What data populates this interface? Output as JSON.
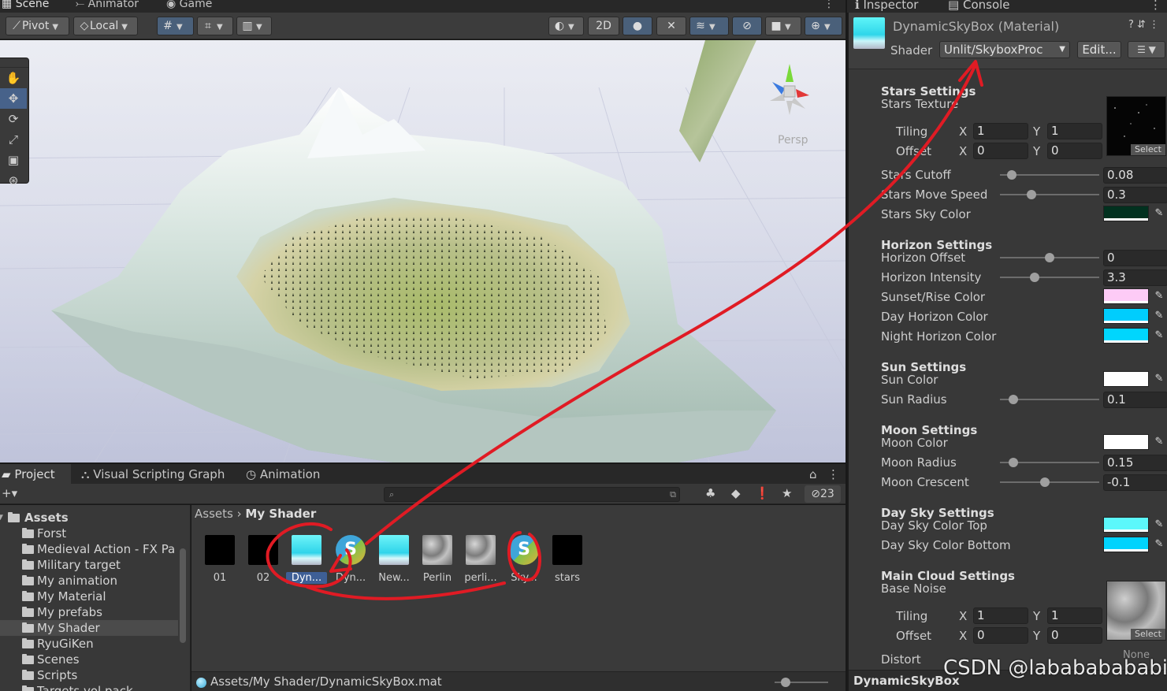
{
  "scene_window": {
    "tabs": [
      {
        "label": "Scene",
        "icon": "grid-icon"
      },
      {
        "label": "Animator",
        "icon": "animator-icon"
      },
      {
        "label": "Game",
        "icon": "gamepad-icon"
      }
    ],
    "toolbar": {
      "pivot_label": "Pivot",
      "local_label": "Local",
      "mode_2d_label": "2D"
    },
    "viewport": {
      "persp_label": "Persp"
    },
    "tools": [
      "hand-tool",
      "move-tool",
      "rotate-tool",
      "scale-tool",
      "rect-tool",
      "transform-tool"
    ]
  },
  "project_panel": {
    "tabs": [
      {
        "label": "Project",
        "icon": "folder-icon"
      },
      {
        "label": "Visual Scripting Graph",
        "icon": "graph-icon"
      },
      {
        "label": "Animation",
        "icon": "clock-icon"
      }
    ],
    "hidden_count": "23",
    "tree": [
      {
        "label": "Assets",
        "level": 0,
        "expanded": true,
        "bold": true
      },
      {
        "label": "Forst",
        "level": 1,
        "has_children": true
      },
      {
        "label": "Medieval Action - FX Pa",
        "level": 1
      },
      {
        "label": "Military target",
        "level": 1,
        "has_children": true
      },
      {
        "label": "My animation",
        "level": 1
      },
      {
        "label": "My Material",
        "level": 1
      },
      {
        "label": "My prefabs",
        "level": 1
      },
      {
        "label": "My Shader",
        "level": 1,
        "selected": true
      },
      {
        "label": "RyuGiKen",
        "level": 1,
        "has_children": true
      },
      {
        "label": "Scenes",
        "level": 1
      },
      {
        "label": "Scripts",
        "level": 1
      },
      {
        "label": "Targets vol pack",
        "level": 1
      }
    ],
    "breadcrumb": {
      "root": "Assets",
      "current": "My Shader"
    },
    "assets": [
      {
        "label": "01",
        "kind": "render-texture",
        "thumb": "#000000"
      },
      {
        "label": "02",
        "kind": "render-texture",
        "thumb": "#000000"
      },
      {
        "label": "Dyn...",
        "kind": "material",
        "selected": true
      },
      {
        "label": "Dyn...",
        "kind": "shader"
      },
      {
        "label": "New...",
        "kind": "material"
      },
      {
        "label": "Perlin",
        "kind": "texture-noise"
      },
      {
        "label": "perli...",
        "kind": "texture-noise"
      },
      {
        "label": "Sky...",
        "kind": "shader"
      },
      {
        "label": "stars",
        "kind": "texture-stars",
        "thumb": "#000000"
      }
    ],
    "status_path": "Assets/My Shader/DynamicSkyBox.mat"
  },
  "inspector": {
    "tabs": [
      {
        "label": "Inspector",
        "icon": "info-icon"
      },
      {
        "label": "Console",
        "icon": "console-icon"
      }
    ],
    "material_title": "DynamicSkyBox (Material)",
    "shader_label": "Shader",
    "shader_value": "Unlit/SkyboxProc",
    "edit_label": "Edit...",
    "sections": {
      "stars": "Stars Settings",
      "horizon": "Horizon Settings",
      "sun": "Sun Settings",
      "moon": "Moon Settings",
      "day_sky": "Day Sky Settings",
      "cloud": "Main Cloud Settings"
    },
    "labels": {
      "stars_texture": "Stars Texture",
      "tiling": "Tiling",
      "offset": "Offset",
      "x": "X",
      "y": "Y",
      "select": "Select",
      "stars_cutoff": "Stars Cutoff",
      "stars_move_speed": "Stars Move Speed",
      "stars_sky_color": "Stars Sky Color",
      "horizon_offset": "Horizon Offset",
      "horizon_intensity": "Horizon Intensity",
      "sunset_rise_color": "Sunset/Rise Color",
      "day_horizon_color": "Day Horizon Color",
      "night_horizon_color": "Night Horizon Color",
      "sun_color": "Sun Color",
      "sun_radius": "Sun Radius",
      "moon_color": "Moon Color",
      "moon_radius": "Moon Radius",
      "moon_crescent": "Moon Crescent",
      "day_sky_color_top": "Day Sky Color Top",
      "day_sky_color_bottom": "Day Sky Color Bottom",
      "base_noise": "Base Noise",
      "distort": "Distort",
      "none": "None"
    },
    "values": {
      "stars_tiling_x": "1",
      "stars_tiling_y": "1",
      "stars_offset_x": "0",
      "stars_offset_y": "0",
      "stars_cutoff": "0.08",
      "stars_move_speed": "0.3",
      "horizon_offset": "0",
      "horizon_intensity": "3.3",
      "sun_radius": "0.1",
      "moon_radius": "0.15",
      "moon_crescent": "-0.1",
      "noise_tiling_x": "1",
      "noise_tiling_y": "1",
      "noise_offset_x": "0",
      "noise_offset_y": "0"
    },
    "slider_fractions": {
      "stars_cutoff": 0.08,
      "stars_move_speed": 0.3,
      "horizon_offset": 0.5,
      "horizon_intensity": 0.33,
      "sun_radius": 0.1,
      "moon_radius": 0.1,
      "moon_crescent": 0.45
    },
    "colors": {
      "stars_sky": "#02311f",
      "sunset_rise": "#fdcbf6",
      "day_horizon": "#00cdfd",
      "night_horizon": "#00d6fd",
      "sun": "#ffffff",
      "moon": "#ffffff",
      "day_sky_top": "#5cf8fb",
      "day_sky_bottom": "#00d3fd"
    },
    "footer_name": "DynamicSkyBox"
  },
  "watermark": "CSDN @labababababidu",
  "annotation_color": "#e01b24"
}
